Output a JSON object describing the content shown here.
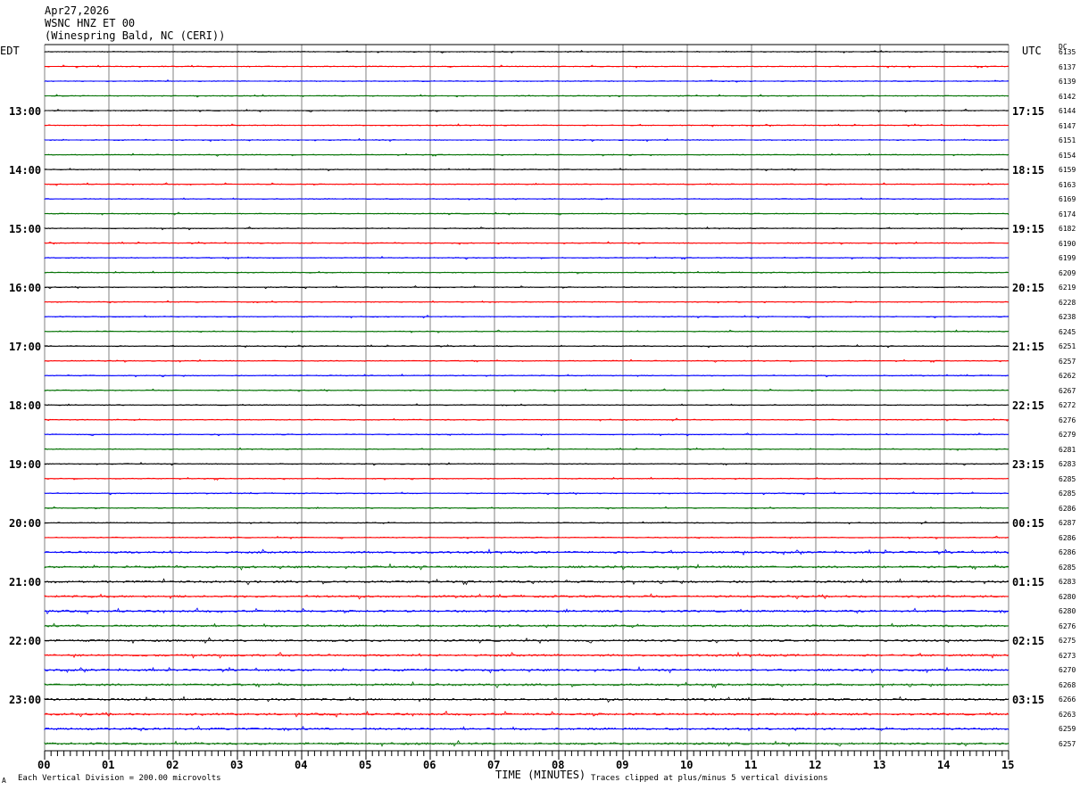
{
  "header": {
    "date": "Apr27,2026",
    "station": "WSNC HNZ ET 00",
    "location": "(Winespring Bald, NC (CERI))"
  },
  "left_tz": "EDT",
  "right_tz": "UTC",
  "dc_label": "DC",
  "footer": {
    "scale_note": "Each Vertical Division =  200.00 microvolts",
    "xlabel": "TIME (MINUTES)",
    "clip_note": "Traces clipped at plus/minus 5 vertical divisions",
    "corner_mark": "A"
  },
  "chart_data": {
    "type": "line",
    "title": "WSNC HNZ ET 00",
    "xlabel": "TIME (MINUTES)",
    "xlim": [
      0,
      15
    ],
    "x_ticks": [
      "00",
      "01",
      "02",
      "03",
      "04",
      "05",
      "06",
      "07",
      "08",
      "09",
      "10",
      "11",
      "12",
      "13",
      "14",
      "15"
    ],
    "grid": true,
    "trace_colors": [
      "#000000",
      "#ff0000",
      "#0000ff",
      "#007000"
    ],
    "left_time_labels": [
      {
        "row": 4,
        "label": "13:00"
      },
      {
        "row": 8,
        "label": "14:00"
      },
      {
        "row": 12,
        "label": "15:00"
      },
      {
        "row": 16,
        "label": "16:00"
      },
      {
        "row": 20,
        "label": "17:00"
      },
      {
        "row": 24,
        "label": "18:00"
      },
      {
        "row": 28,
        "label": "19:00"
      },
      {
        "row": 32,
        "label": "20:00"
      },
      {
        "row": 36,
        "label": "21:00"
      },
      {
        "row": 40,
        "label": "22:00"
      },
      {
        "row": 44,
        "label": "23:00"
      }
    ],
    "right_time_labels": [
      {
        "row": 4,
        "label": "17:15"
      },
      {
        "row": 8,
        "label": "18:15"
      },
      {
        "row": 12,
        "label": "19:15"
      },
      {
        "row": 16,
        "label": "20:15"
      },
      {
        "row": 20,
        "label": "21:15"
      },
      {
        "row": 24,
        "label": "22:15"
      },
      {
        "row": 28,
        "label": "23:15"
      },
      {
        "row": 32,
        "label": "00:15"
      },
      {
        "row": 36,
        "label": "01:15"
      },
      {
        "row": 40,
        "label": "02:15"
      },
      {
        "row": 44,
        "label": "03:15"
      }
    ],
    "dc_offsets": [
      "6135",
      "6137",
      "6139",
      "6142",
      "6144",
      "6147",
      "6151",
      "6154",
      "6159",
      "6163",
      "6169",
      "6174",
      "6182",
      "6190",
      "6199",
      "6209",
      "6219",
      "6228",
      "6238",
      "6245",
      "6251",
      "6257",
      "6262",
      "6267",
      "6272",
      "6276",
      "6279",
      "6281",
      "6283",
      "6285",
      "6285",
      "6286",
      "6287",
      "6286",
      "6286",
      "6285",
      "6283",
      "6280",
      "6280",
      "6276",
      "6275",
      "6273",
      "6270",
      "6268",
      "6266",
      "6263",
      "6259",
      "6257"
    ]
  }
}
